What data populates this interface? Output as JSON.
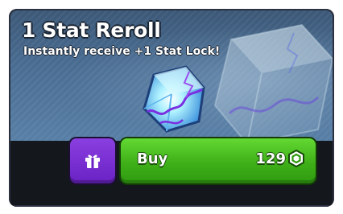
{
  "card": {
    "title": "1 Stat Reroll",
    "subtitle": "Instantly receive +1 Stat Lock!",
    "item_icon": "reroll-cube-icon",
    "gift_icon": "gift-icon",
    "buy_label": "Buy",
    "price": "129",
    "currency_icon": "robux-icon"
  },
  "colors": {
    "banner": "#4a6e93",
    "gift_button": "#7a30d4",
    "buy_button": "#45b81c",
    "card_background": "#101318"
  }
}
